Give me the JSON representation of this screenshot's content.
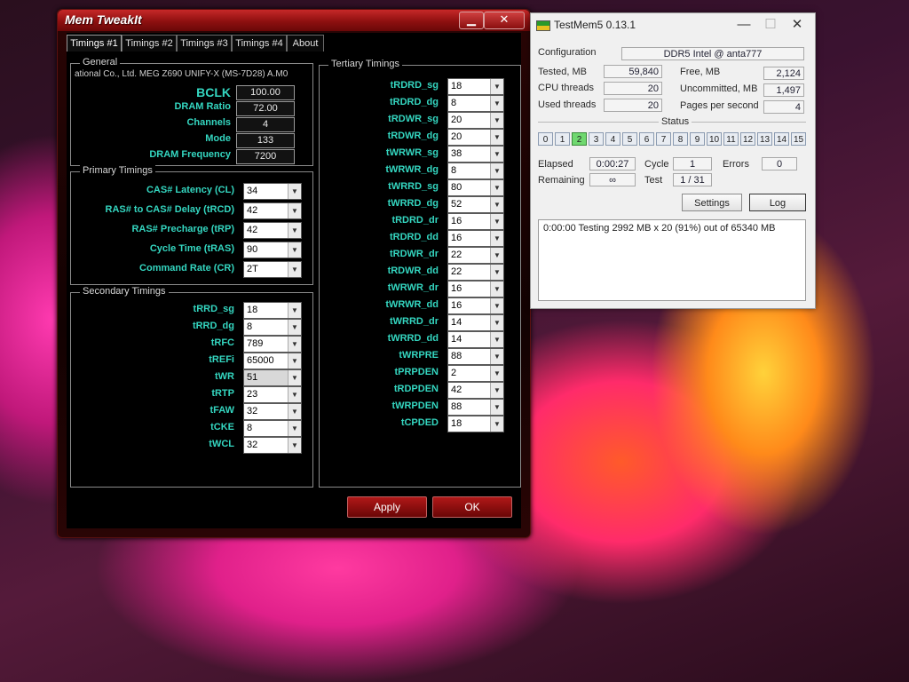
{
  "memtweakit": {
    "title": "Mem TweakIt",
    "tabs": [
      "Timings #1",
      "Timings #2",
      "Timings #3",
      "Timings #4",
      "About"
    ],
    "general": {
      "legend": "General",
      "board": "ational Co., Ltd. MEG Z690 UNIFY-X (MS-7D28) A.M0",
      "rows": [
        {
          "label": "BCLK",
          "value": "100.00"
        },
        {
          "label": "DRAM Ratio",
          "value": "72.00"
        },
        {
          "label": "Channels",
          "value": "4"
        },
        {
          "label": "Mode",
          "value": "133"
        },
        {
          "label": "DRAM Frequency",
          "value": "7200"
        }
      ]
    },
    "primary": {
      "legend": "Primary Timings",
      "rows": [
        {
          "label": "CAS# Latency (CL)",
          "value": "34"
        },
        {
          "label": "RAS# to CAS# Delay (tRCD)",
          "value": "42"
        },
        {
          "label": "RAS# Precharge (tRP)",
          "value": "42"
        },
        {
          "label": "Cycle Time (tRAS)",
          "value": "90"
        },
        {
          "label": "Command Rate (CR)",
          "value": "2T"
        }
      ]
    },
    "secondary": {
      "legend": "Secondary Timings",
      "rows": [
        {
          "label": "tRRD_sg",
          "value": "18"
        },
        {
          "label": "tRRD_dg",
          "value": "8"
        },
        {
          "label": "tRFC",
          "value": "789"
        },
        {
          "label": "tREFi",
          "value": "65000"
        },
        {
          "label": "tWR",
          "value": "51"
        },
        {
          "label": "tRTP",
          "value": "23"
        },
        {
          "label": "tFAW",
          "value": "32"
        },
        {
          "label": "tCKE",
          "value": "8"
        },
        {
          "label": "tWCL",
          "value": "32"
        }
      ]
    },
    "tertiary": {
      "legend": "Tertiary Timings",
      "rows": [
        {
          "label": "tRDRD_sg",
          "value": "18"
        },
        {
          "label": "tRDRD_dg",
          "value": "8"
        },
        {
          "label": "tRDWR_sg",
          "value": "20"
        },
        {
          "label": "tRDWR_dg",
          "value": "20"
        },
        {
          "label": "tWRWR_sg",
          "value": "38"
        },
        {
          "label": "tWRWR_dg",
          "value": "8"
        },
        {
          "label": "tWRRD_sg",
          "value": "80"
        },
        {
          "label": "tWRRD_dg",
          "value": "52"
        },
        {
          "label": "tRDRD_dr",
          "value": "16"
        },
        {
          "label": "tRDRD_dd",
          "value": "16"
        },
        {
          "label": "tRDWR_dr",
          "value": "22"
        },
        {
          "label": "tRDWR_dd",
          "value": "22"
        },
        {
          "label": "tWRWR_dr",
          "value": "16"
        },
        {
          "label": "tWRWR_dd",
          "value": "16"
        },
        {
          "label": "tWRRD_dr",
          "value": "14"
        },
        {
          "label": "tWRRD_dd",
          "value": "14"
        },
        {
          "label": "tWRPRE",
          "value": "88"
        },
        {
          "label": "tPRPDEN",
          "value": "2"
        },
        {
          "label": "tRDPDEN",
          "value": "42"
        },
        {
          "label": "tWRPDEN",
          "value": "88"
        },
        {
          "label": "tCPDED",
          "value": "18"
        }
      ]
    },
    "apply_label": "Apply",
    "ok_label": "OK",
    "minimize_glyph": "▁",
    "close_glyph": "✕"
  },
  "testmem": {
    "title": "TestMem5  0.13.1",
    "configuration_label": "Configuration",
    "configuration_value": "DDR5 Intel @ anta777",
    "tested_label": "Tested, MB",
    "tested_value": "59,840",
    "free_label": "Free, MB",
    "free_value": "2,124",
    "cpu_threads_label": "CPU threads",
    "cpu_threads_value": "20",
    "uncommitted_label": "Uncommitted, MB",
    "uncommitted_value": "1,497",
    "used_threads_label": "Used threads",
    "used_threads_value": "20",
    "pages_label": "Pages per second",
    "pages_value": "4",
    "status_label": "Status",
    "status_cells": [
      "0",
      "1",
      "2",
      "3",
      "4",
      "5",
      "6",
      "7",
      "8",
      "9",
      "10",
      "11",
      "12",
      "13",
      "14",
      "15"
    ],
    "active_cell": 2,
    "elapsed_label": "Elapsed",
    "elapsed_value": "0:00:27",
    "cycle_label": "Cycle",
    "cycle_value": "1",
    "errors_label": "Errors",
    "errors_value": "0",
    "remaining_label": "Remaining",
    "remaining_value": "∞",
    "test_label": "Test",
    "test_value": "1 / 31",
    "settings_label": "Settings",
    "log_label": "Log",
    "log_text": "0:00:00  Testing 2992 MB x 20 (91%) out of 65340 MB",
    "min_glyph": "—",
    "max_glyph": "☐",
    "close_glyph": "✕"
  }
}
